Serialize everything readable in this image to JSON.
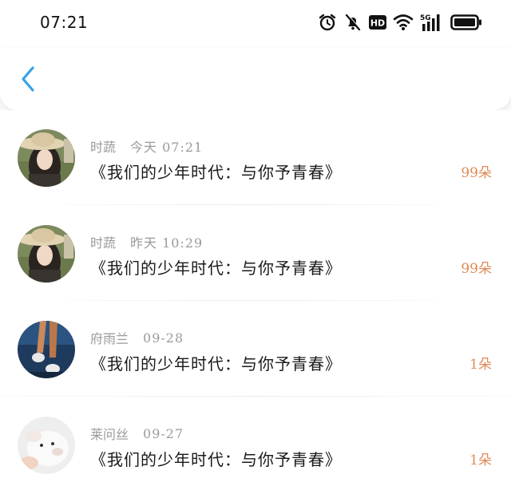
{
  "status_bar": {
    "time": "07:21",
    "icons": [
      "alarm-icon",
      "mute-icon",
      "hd-icon",
      "wifi-icon",
      "5g-signal-icon",
      "battery-icon"
    ],
    "hd_label": "HD",
    "network_label": "5G"
  },
  "nav": {
    "back_icon": "chevron-left-icon",
    "accent_color": "#3aa0e6"
  },
  "records": [
    {
      "name": "时蔬",
      "date": "今天 07:21",
      "message": "《我们的少年时代：与你予青春》",
      "count": "99朵",
      "avatar": "hat-girl-avatar"
    },
    {
      "name": "时蔬",
      "date": "昨天 10:29",
      "message": "《我们的少年时代：与你予青春》",
      "count": "99朵",
      "avatar": "hat-girl-avatar"
    },
    {
      "name": "府雨兰",
      "date": "09-28",
      "message": "《我们的少年时代：与你予青春》",
      "count": "1朵",
      "avatar": "runner-legs-avatar"
    },
    {
      "name": "莱问丝",
      "date": "09-27",
      "message": "《我们的少年时代：与你予青春》",
      "count": "1朵",
      "avatar": "white-dog-avatar"
    }
  ],
  "colors": {
    "count": "#e08a55",
    "meta": "#9a9a9a",
    "message": "#1a1a1a"
  }
}
